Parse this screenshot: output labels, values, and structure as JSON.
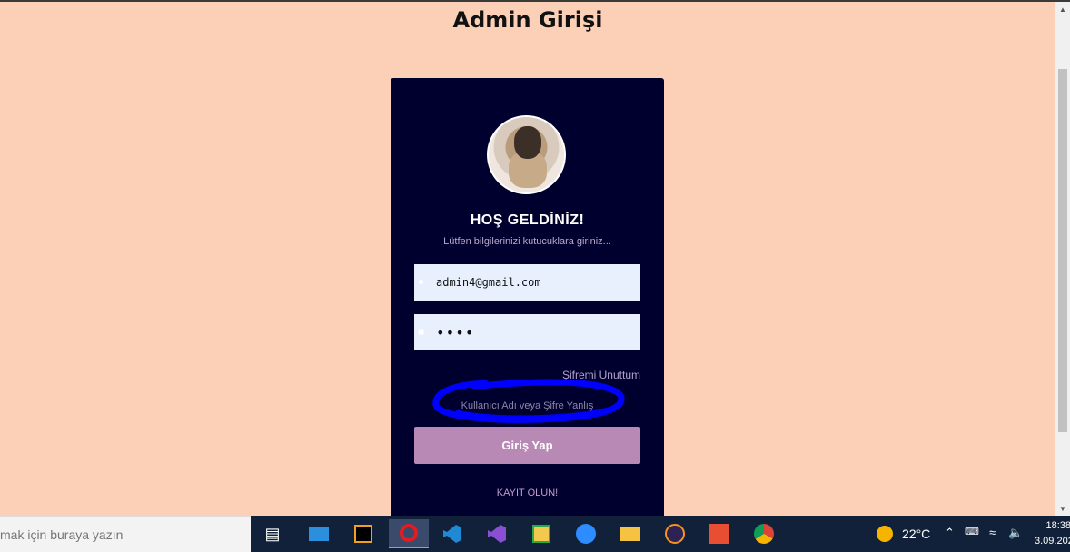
{
  "page": {
    "title": "Admin Girişi"
  },
  "login": {
    "welcome": "HOŞ GELDİNİZ!",
    "subtitle": "Lütfen bilgilerinizi kutucuklara giriniz...",
    "email_value": "admin4@gmail.com",
    "password_value": "••••",
    "forgot_label": "Şifremi Unuttum",
    "error_message": "Kullanıcı Adı veya Şifre Yanlış",
    "submit_label": "Giriş Yap",
    "register_label": "KAYIT OLUN!"
  },
  "taskbar": {
    "search_placeholder": "mak için buraya yazın",
    "apps": [
      "task-view",
      "mail",
      "intellij",
      "opera",
      "vscode",
      "visual-studio",
      "snipping",
      "zoom",
      "file-explorer",
      "eclipse",
      "git",
      "chrome"
    ],
    "temperature": "22°C",
    "time": "18:38",
    "date": "3.09.202"
  },
  "colors": {
    "page_bg": "#fbd0b6",
    "card_bg": "#00002e",
    "button_bg": "#b889b5",
    "scribble": "#0000ff"
  }
}
